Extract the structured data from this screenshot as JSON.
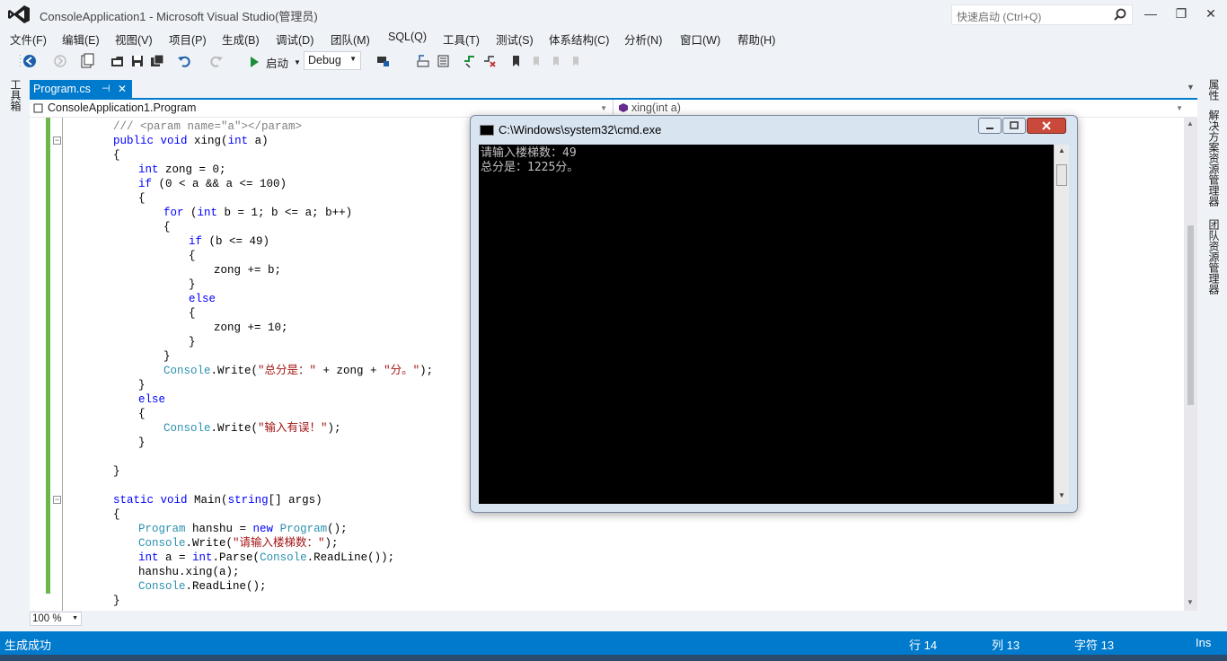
{
  "window": {
    "title": "ConsoleApplication1 - Microsoft Visual Studio(管理员)",
    "quick_launch_placeholder": "快速启动 (Ctrl+Q)",
    "minimize": "—",
    "restore": "❐",
    "close": "✕"
  },
  "menu": [
    "文件(F)",
    "编辑(E)",
    "视图(V)",
    "项目(P)",
    "生成(B)",
    "调试(D)",
    "团队(M)",
    "SQL(Q)",
    "工具(T)",
    "测试(S)",
    "体系结构(C)",
    "分析(N)",
    "窗口(W)",
    "帮助(H)"
  ],
  "toolbar": {
    "start_label": "启动",
    "configuration": "Debug"
  },
  "left_strip": {
    "toolbox": "工具箱"
  },
  "right_strip": {
    "properties": "属性",
    "solution_explorer": "解决方案资源管理器",
    "team_explorer": "团队资源管理器"
  },
  "tab": {
    "label": "Program.cs",
    "pin": "⊣",
    "close": "✕"
  },
  "navbar": {
    "type": "ConsoleApplication1.Program",
    "member": "xing(int a)"
  },
  "code": [
    {
      "t": [
        [
          "cm",
          "/// <param name=\"a\"></param>"
        ]
      ],
      "indent": 0
    },
    {
      "t": [
        [
          "kw",
          "public"
        ],
        [
          "",
          " "
        ],
        [
          "kw",
          "void"
        ],
        [
          "",
          " xing("
        ],
        [
          "kw",
          "int"
        ],
        [
          "",
          " a)"
        ]
      ],
      "indent": 0
    },
    {
      "t": [
        [
          "",
          "{"
        ]
      ],
      "indent": 0
    },
    {
      "t": [
        [
          "kw",
          "int"
        ],
        [
          "",
          " zong = 0;"
        ]
      ],
      "indent": 1
    },
    {
      "t": [
        [
          "kw",
          "if"
        ],
        [
          "",
          " (0 < a && a <= 100)"
        ]
      ],
      "indent": 1
    },
    {
      "t": [
        [
          "",
          "{"
        ]
      ],
      "indent": 1
    },
    {
      "t": [
        [
          "kw",
          "for"
        ],
        [
          "",
          " ("
        ],
        [
          "kw",
          "int"
        ],
        [
          "",
          " b = 1; b <= a; b++)"
        ]
      ],
      "indent": 2
    },
    {
      "t": [
        [
          "",
          "{"
        ]
      ],
      "indent": 2
    },
    {
      "t": [
        [
          "kw",
          "if"
        ],
        [
          "",
          " (b <= 49)"
        ]
      ],
      "indent": 3
    },
    {
      "t": [
        [
          "",
          "{"
        ]
      ],
      "indent": 3
    },
    {
      "t": [
        [
          "",
          "zong += b;"
        ]
      ],
      "indent": 4
    },
    {
      "t": [
        [
          "",
          "}"
        ]
      ],
      "indent": 3
    },
    {
      "t": [
        [
          "kw",
          "else"
        ]
      ],
      "indent": 3
    },
    {
      "t": [
        [
          "",
          "{"
        ]
      ],
      "indent": 3
    },
    {
      "t": [
        [
          "",
          "zong += 10;"
        ]
      ],
      "indent": 4
    },
    {
      "t": [
        [
          "",
          "}"
        ]
      ],
      "indent": 3
    },
    {
      "t": [
        [
          "",
          "}"
        ]
      ],
      "indent": 2
    },
    {
      "t": [
        [
          "ty",
          "Console"
        ],
        [
          "",
          ".Write("
        ],
        [
          "st",
          "\"总分是：\""
        ],
        [
          "",
          " + zong + "
        ],
        [
          "st",
          "\"分。\""
        ],
        [
          "",
          ");"
        ]
      ],
      "indent": 2
    },
    {
      "t": [
        [
          "",
          "}"
        ]
      ],
      "indent": 1
    },
    {
      "t": [
        [
          "kw",
          "else"
        ]
      ],
      "indent": 1
    },
    {
      "t": [
        [
          "",
          "{"
        ]
      ],
      "indent": 1
    },
    {
      "t": [
        [
          "ty",
          "Console"
        ],
        [
          "",
          ".Write("
        ],
        [
          "st",
          "\"输入有误！\""
        ],
        [
          "",
          ");"
        ]
      ],
      "indent": 2
    },
    {
      "t": [
        [
          "",
          "}"
        ]
      ],
      "indent": 1
    },
    {
      "t": [],
      "indent": 0
    },
    {
      "t": [
        [
          "",
          "}"
        ]
      ],
      "indent": 0
    },
    {
      "t": [],
      "indent": 0
    },
    {
      "t": [
        [
          "kw",
          "static"
        ],
        [
          "",
          " "
        ],
        [
          "kw",
          "void"
        ],
        [
          "",
          " Main("
        ],
        [
          "kw",
          "string"
        ],
        [
          "",
          "[] args)"
        ]
      ],
      "indent": 0
    },
    {
      "t": [
        [
          "",
          "{"
        ]
      ],
      "indent": 0
    },
    {
      "t": [
        [
          "ty",
          "Program"
        ],
        [
          "",
          " hanshu = "
        ],
        [
          "kw",
          "new"
        ],
        [
          "",
          " "
        ],
        [
          "ty",
          "Program"
        ],
        [
          "",
          "();"
        ]
      ],
      "indent": 1
    },
    {
      "t": [
        [
          "ty",
          "Console"
        ],
        [
          "",
          ".Write("
        ],
        [
          "st",
          "\"请输入楼梯数：\""
        ],
        [
          "",
          ");"
        ]
      ],
      "indent": 1
    },
    {
      "t": [
        [
          "kw",
          "int"
        ],
        [
          "",
          " a = "
        ],
        [
          "kw",
          "int"
        ],
        [
          "",
          ".Parse("
        ],
        [
          "ty",
          "Console"
        ],
        [
          "",
          ".ReadLine());"
        ]
      ],
      "indent": 1
    },
    {
      "t": [
        [
          "",
          "hanshu.xing(a);"
        ]
      ],
      "indent": 1
    },
    {
      "t": [
        [
          "ty",
          "Console"
        ],
        [
          "",
          ".ReadLine();"
        ]
      ],
      "indent": 1
    },
    {
      "t": [
        [
          "",
          "}"
        ]
      ],
      "indent": 0
    }
  ],
  "zoom": "100 %",
  "status": {
    "message": "生成成功",
    "line": "行 14",
    "col": "列 13",
    "char": "字符 13",
    "mode": "Ins"
  },
  "cmd": {
    "title": "C:\\Windows\\system32\\cmd.exe",
    "lines": [
      "请输入楼梯数：49",
      "总分是：1225分。"
    ]
  }
}
